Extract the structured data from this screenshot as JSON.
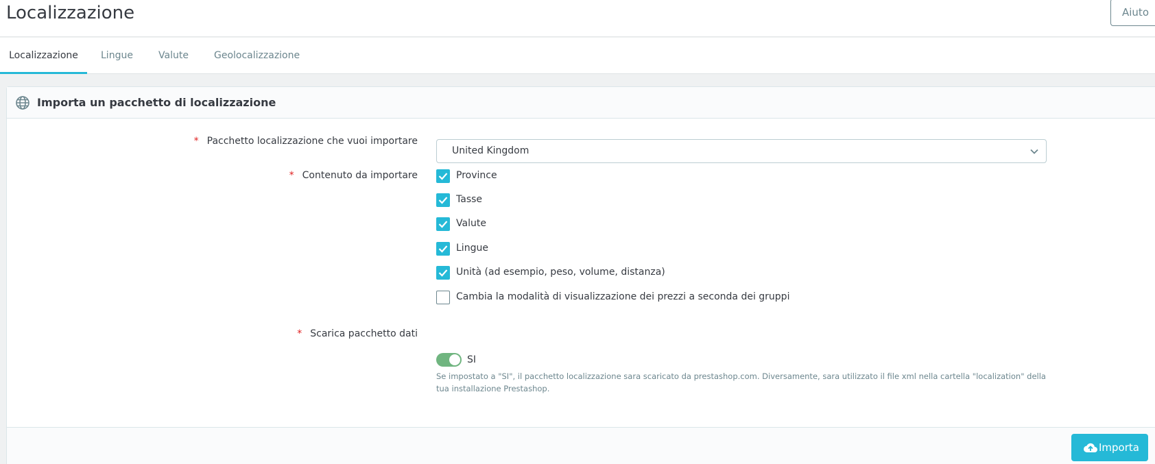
{
  "header": {
    "title": "Localizzazione",
    "help_label": "Aiuto"
  },
  "tabs": [
    {
      "label": "Localizzazione",
      "active": true
    },
    {
      "label": "Lingue",
      "active": false
    },
    {
      "label": "Valute",
      "active": false
    },
    {
      "label": "Geolocalizzazione",
      "active": false
    }
  ],
  "panel": {
    "icon": "globe-icon",
    "title": "Importa un pacchetto di localizzazione",
    "fields": {
      "pack": {
        "required_mark": "*",
        "label": "Pacchetto localizzazione che vuoi importare",
        "value": "United Kingdom"
      },
      "content": {
        "required_mark": "*",
        "label": "Contenuto da importare",
        "options": [
          {
            "label": "Province",
            "checked": true
          },
          {
            "label": "Tasse",
            "checked": true
          },
          {
            "label": "Valute",
            "checked": true
          },
          {
            "label": "Lingue",
            "checked": true
          },
          {
            "label": "Unità (ad esempio, peso, volume, distanza)",
            "checked": true
          },
          {
            "label": "Cambia la modalità di visualizzazione dei prezzi a seconda dei gruppi",
            "checked": false
          }
        ]
      },
      "download": {
        "required_mark": "*",
        "label": "Scarica pacchetto dati",
        "toggle_on": true,
        "toggle_label": "SI",
        "help_text": "Se impostato a \"SI\", il pacchetto localizzazione sara scaricato da prestashop.com. Diversamente, sara utilizzato il file xml nella cartella \"localization\" della tua installazione Prestashop."
      }
    },
    "submit_label": "Importa"
  },
  "colors": {
    "accent": "#25b9d7",
    "toggle_on": "#70b580",
    "required": "#e02020"
  }
}
